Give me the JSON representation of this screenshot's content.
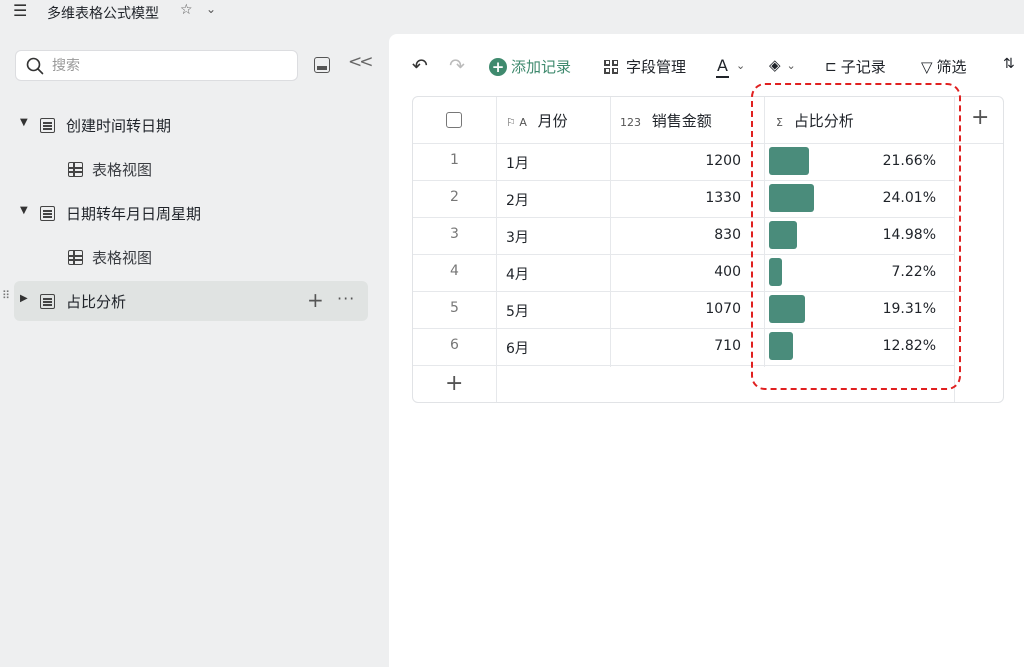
{
  "header": {
    "menu_icon": "hamburger-icon",
    "title": "多维表格公式模型",
    "star_icon": "star-icon",
    "chevron_icon": "chevron-down-icon"
  },
  "sidebar": {
    "search_placeholder": "搜索",
    "items": [
      {
        "label": "创建时间转日期",
        "type": "table",
        "expanded": true
      },
      {
        "label": "表格视图",
        "type": "view"
      },
      {
        "label": "日期转年月日周星期",
        "type": "table",
        "expanded": true
      },
      {
        "label": "表格视图",
        "type": "view"
      },
      {
        "label": "占比分析",
        "type": "table",
        "expanded": false,
        "active": true
      }
    ]
  },
  "toolbar": {
    "add_record": "添加记录",
    "field_manage": "字段管理",
    "font_color": "A",
    "sub_record": "子记录",
    "filter": "筛选",
    "sort_icon": "sort-icon"
  },
  "table": {
    "columns": [
      {
        "icon": "⚐ A",
        "label": "月份"
      },
      {
        "icon": "123",
        "label": "销售金额"
      },
      {
        "icon": "Σ",
        "label": "占比分析"
      }
    ],
    "rows": [
      {
        "num": "1",
        "month": "1月",
        "amount": "1200",
        "pct": "21.66%",
        "ratio": 0.2166
      },
      {
        "num": "2",
        "month": "2月",
        "amount": "1330",
        "pct": "24.01%",
        "ratio": 0.2401
      },
      {
        "num": "3",
        "month": "3月",
        "amount": "830",
        "pct": "14.98%",
        "ratio": 0.1498
      },
      {
        "num": "4",
        "month": "4月",
        "amount": "400",
        "pct": "7.22%",
        "ratio": 0.0722
      },
      {
        "num": "5",
        "month": "5月",
        "amount": "1070",
        "pct": "19.31%",
        "ratio": 0.1931
      },
      {
        "num": "6",
        "month": "6月",
        "amount": "710",
        "pct": "12.82%",
        "ratio": 0.1282
      }
    ],
    "bar_color": "#4a8c7b",
    "highlight_color": "#e02020"
  }
}
